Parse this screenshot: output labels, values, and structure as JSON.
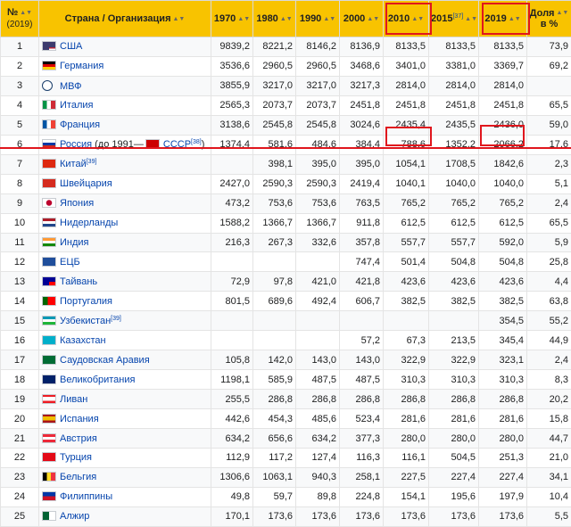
{
  "headers": {
    "rank": "№",
    "rank_sub": "(2019)",
    "name": "Страна / Организация",
    "y1970": "1970",
    "y1980": "1980",
    "y1990": "1990",
    "y2000": "2000",
    "y2010": "2010",
    "y2015": "2015",
    "y2015_ref": "[37]",
    "y2019": "2019",
    "share1": "Доля",
    "share2": "в %"
  },
  "sort_icon": "sort-arrows-icon",
  "highlight_color": "#e0161d",
  "header_color": "#f8c300",
  "rows": [
    {
      "rank": "1",
      "flag": "us",
      "name": "США",
      "v1970": "9839,2",
      "v1980": "8221,2",
      "v1990": "8146,2",
      "v2000": "8136,9",
      "v2010": "8133,5",
      "v2015": "8133,5",
      "v2019": "8133,5",
      "share": "73,9"
    },
    {
      "rank": "2",
      "flag": "de",
      "name": "Германия",
      "v1970": "3536,6",
      "v1980": "2960,5",
      "v1990": "2960,5",
      "v2000": "3468,6",
      "v2010": "3401,0",
      "v2015": "3381,0",
      "v2019": "3369,7",
      "share": "69,2"
    },
    {
      "rank": "3",
      "flag": "imf",
      "name": "МВФ",
      "v1970": "3855,9",
      "v1980": "3217,0",
      "v1990": "3217,0",
      "v2000": "3217,3",
      "v2010": "2814,0",
      "v2015": "2814,0",
      "v2019": "2814,0",
      "share": ""
    },
    {
      "rank": "4",
      "flag": "it",
      "name": "Италия",
      "v1970": "2565,3",
      "v1980": "2073,7",
      "v1990": "2073,7",
      "v2000": "2451,8",
      "v2010": "2451,8",
      "v2015": "2451,8",
      "v2019": "2451,8",
      "share": "65,5"
    },
    {
      "rank": "5",
      "flag": "fr",
      "name": "Франция",
      "v1970": "3138,6",
      "v1980": "2545,8",
      "v1990": "2545,8",
      "v2000": "3024,6",
      "v2010": "2435,4",
      "v2015": "2435,5",
      "v2019": "2436,0",
      "share": "59,0"
    },
    {
      "rank": "6",
      "flag": "ru",
      "name": "Россия",
      "name_extra": "(до 1991—",
      "name_link2": "СССР",
      "name_ref": "[38]",
      "name_close": ")",
      "v1970": "1374,4",
      "v1980": "581,6",
      "v1990": "484,6",
      "v2000": "384,4",
      "v2010": "788,6",
      "v2015": "1352,2",
      "v2019": "2066,2",
      "share": "17,6"
    },
    {
      "rank": "7",
      "flag": "cn",
      "name": "Китай",
      "name_ref": "[39]",
      "v1970": "",
      "v1980": "398,1",
      "v1990": "395,0",
      "v2000": "395,0",
      "v2010": "1054,1",
      "v2015": "1708,5",
      "v2019": "1842,6",
      "share": "2,3"
    },
    {
      "rank": "8",
      "flag": "ch",
      "name": "Швейцария",
      "v1970": "2427,0",
      "v1980": "2590,3",
      "v1990": "2590,3",
      "v2000": "2419,4",
      "v2010": "1040,1",
      "v2015": "1040,0",
      "v2019": "1040,0",
      "share": "5,1"
    },
    {
      "rank": "9",
      "flag": "jp",
      "name": "Япония",
      "v1970": "473,2",
      "v1980": "753,6",
      "v1990": "753,6",
      "v2000": "763,5",
      "v2010": "765,2",
      "v2015": "765,2",
      "v2019": "765,2",
      "share": "2,4"
    },
    {
      "rank": "10",
      "flag": "nl",
      "name": "Нидерланды",
      "v1970": "1588,2",
      "v1980": "1366,7",
      "v1990": "1366,7",
      "v2000": "911,8",
      "v2010": "612,5",
      "v2015": "612,5",
      "v2019": "612,5",
      "share": "65,5"
    },
    {
      "rank": "11",
      "flag": "in",
      "name": "Индия",
      "v1970": "216,3",
      "v1980": "267,3",
      "v1990": "332,6",
      "v2000": "357,8",
      "v2010": "557,7",
      "v2015": "557,7",
      "v2019": "592,0",
      "share": "5,9"
    },
    {
      "rank": "12",
      "flag": "ecb",
      "name": "ЕЦБ",
      "v1970": "",
      "v1980": "",
      "v1990": "",
      "v2000": "747,4",
      "v2010": "501,4",
      "v2015": "504,8",
      "v2019": "504,8",
      "share": "25,8"
    },
    {
      "rank": "13",
      "flag": "tw",
      "name": "Тайвань",
      "v1970": "72,9",
      "v1980": "97,8",
      "v1990": "421,0",
      "v2000": "421,8",
      "v2010": "423,6",
      "v2015": "423,6",
      "v2019": "423,6",
      "share": "4,4"
    },
    {
      "rank": "14",
      "flag": "pt",
      "name": "Португалия",
      "v1970": "801,5",
      "v1980": "689,6",
      "v1990": "492,4",
      "v2000": "606,7",
      "v2010": "382,5",
      "v2015": "382,5",
      "v2019": "382,5",
      "share": "63,8"
    },
    {
      "rank": "15",
      "flag": "uz",
      "name": "Узбекистан",
      "name_ref": "[39]",
      "v1970": "",
      "v1980": "",
      "v1990": "",
      "v2000": "",
      "v2010": "",
      "v2015": "",
      "v2019": "354,5",
      "share": "55,2"
    },
    {
      "rank": "16",
      "flag": "kz",
      "name": "Казахстан",
      "v1970": "",
      "v1980": "",
      "v1990": "",
      "v2000": "57,2",
      "v2010": "67,3",
      "v2015": "213,5",
      "v2019": "345,4",
      "share": "44,9"
    },
    {
      "rank": "17",
      "flag": "sa",
      "name": "Саудовская Аравия",
      "v1970": "105,8",
      "v1980": "142,0",
      "v1990": "143,0",
      "v2000": "143,0",
      "v2010": "322,9",
      "v2015": "322,9",
      "v2019": "323,1",
      "share": "2,4"
    },
    {
      "rank": "18",
      "flag": "gb",
      "name": "Великобритания",
      "v1970": "1198,1",
      "v1980": "585,9",
      "v1990": "487,5",
      "v2000": "487,5",
      "v2010": "310,3",
      "v2015": "310,3",
      "v2019": "310,3",
      "share": "8,3"
    },
    {
      "rank": "19",
      "flag": "lb",
      "name": "Ливан",
      "v1970": "255,5",
      "v1980": "286,8",
      "v1990": "286,8",
      "v2000": "286,8",
      "v2010": "286,8",
      "v2015": "286,8",
      "v2019": "286,8",
      "share": "20,2"
    },
    {
      "rank": "20",
      "flag": "es",
      "name": "Испания",
      "v1970": "442,6",
      "v1980": "454,3",
      "v1990": "485,6",
      "v2000": "523,4",
      "v2010": "281,6",
      "v2015": "281,6",
      "v2019": "281,6",
      "share": "15,8"
    },
    {
      "rank": "21",
      "flag": "at",
      "name": "Австрия",
      "v1970": "634,2",
      "v1980": "656,6",
      "v1990": "634,2",
      "v2000": "377,3",
      "v2010": "280,0",
      "v2015": "280,0",
      "v2019": "280,0",
      "share": "44,7"
    },
    {
      "rank": "22",
      "flag": "tr",
      "name": "Турция",
      "v1970": "112,9",
      "v1980": "117,2",
      "v1990": "127,4",
      "v2000": "116,3",
      "v2010": "116,1",
      "v2015": "504,5",
      "v2019": "251,3",
      "share": "21,0"
    },
    {
      "rank": "23",
      "flag": "be",
      "name": "Бельгия",
      "v1970": "1306,6",
      "v1980": "1063,1",
      "v1990": "940,3",
      "v2000": "258,1",
      "v2010": "227,5",
      "v2015": "227,4",
      "v2019": "227,4",
      "share": "34,1"
    },
    {
      "rank": "24",
      "flag": "ph",
      "name": "Филиппины",
      "v1970": "49,8",
      "v1980": "59,7",
      "v1990": "89,8",
      "v2000": "224,8",
      "v2010": "154,1",
      "v2015": "195,6",
      "v2019": "197,9",
      "share": "10,4"
    },
    {
      "rank": "25",
      "flag": "dz",
      "name": "Алжир",
      "v1970": "170,1",
      "v1980": "173,6",
      "v1990": "173,6",
      "v2000": "173,6",
      "v2010": "173,6",
      "v2015": "173,6",
      "v2019": "173,6",
      "share": "5,5"
    }
  ]
}
